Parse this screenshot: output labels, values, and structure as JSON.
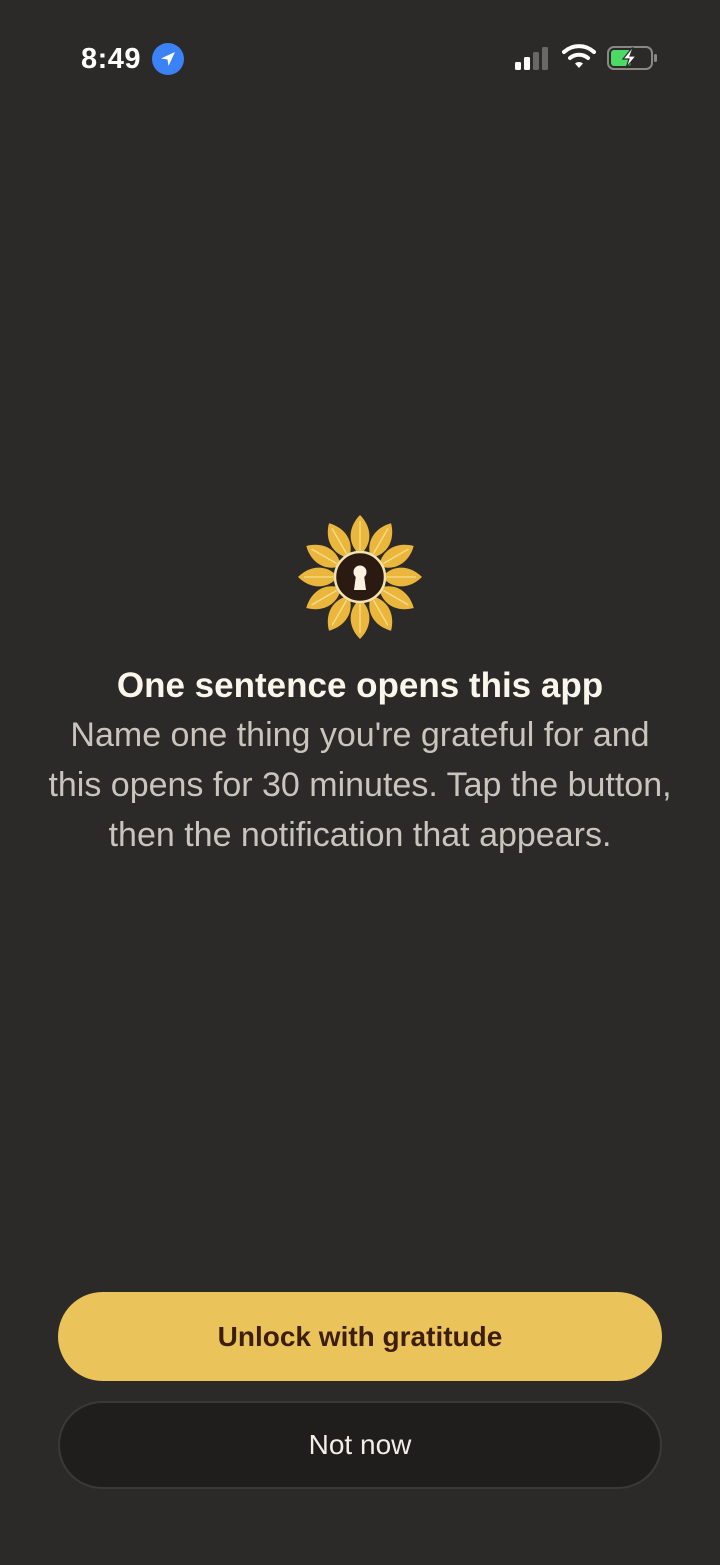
{
  "status_bar": {
    "time": "8:49",
    "location_icon": "location-arrow-icon",
    "signal_icon": "cellular-signal-icon",
    "wifi_icon": "wifi-icon",
    "battery_icon": "battery-charging-icon"
  },
  "hero": {
    "logo_icon": "sunflower-keyhole-icon",
    "title": "One sentence opens this app",
    "body": "Name one thing you're grateful for and this opens for 30 minutes. Tap the button, then the notification that appears."
  },
  "actions": {
    "primary_label": "Unlock with gratitude",
    "secondary_label": "Not now"
  },
  "colors": {
    "background": "#2c2a28",
    "accent": "#eac45a",
    "primary_text": "#3d1e0e",
    "secondary_button": "#1f1e1c"
  }
}
